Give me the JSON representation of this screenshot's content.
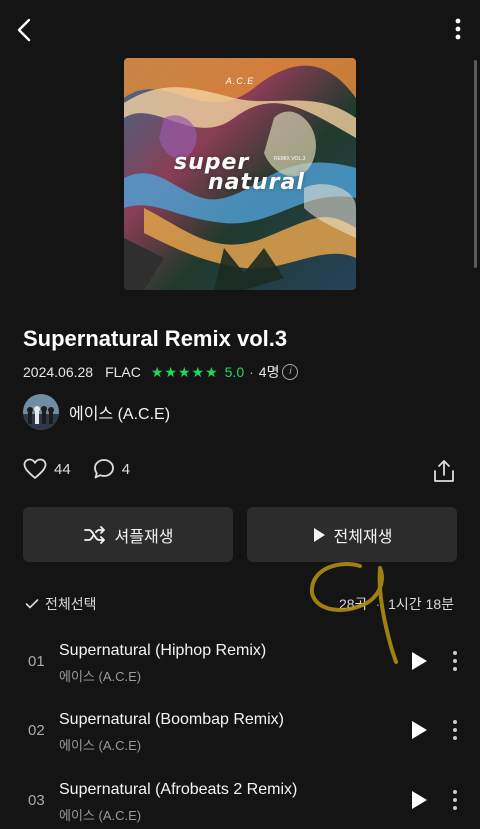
{
  "header": {
    "back_icon": "chevron-left-icon",
    "more_icon": "more-vertical-icon"
  },
  "album": {
    "cover_brand": "A.C.E",
    "cover_word1": "super",
    "cover_word2": "natural",
    "cover_sub": "REMIX VOL.3",
    "title": "Supernatural Remix vol.3",
    "date": "2024.06.28",
    "format": "FLAC",
    "stars": "★★★★★",
    "rating": "5.0",
    "rater_count": "4명"
  },
  "artist": {
    "name": "에이스 (A.C.E)"
  },
  "social": {
    "likes": "44",
    "comments": "4"
  },
  "buttons": {
    "shuffle_label": "셔플재생",
    "play_all_label": "전체재생"
  },
  "list_header": {
    "select_all": "전체선택",
    "track_count": "28곡",
    "duration": "1시간 18분"
  },
  "tracks": [
    {
      "num": "01",
      "title": "Supernatural (Hiphop Remix)",
      "artist": "에이스 (A.C.E)"
    },
    {
      "num": "02",
      "title": "Supernatural (Boombap Remix)",
      "artist": "에이스 (A.C.E)"
    },
    {
      "num": "03",
      "title": "Supernatural (Afrobeats 2 Remix)",
      "artist": "에이스 (A.C.E)"
    }
  ],
  "colors": {
    "accent_green": "#1fd95a",
    "background": "#141414",
    "button_bg": "#2c2c2c",
    "scribble": "#b8940f"
  }
}
